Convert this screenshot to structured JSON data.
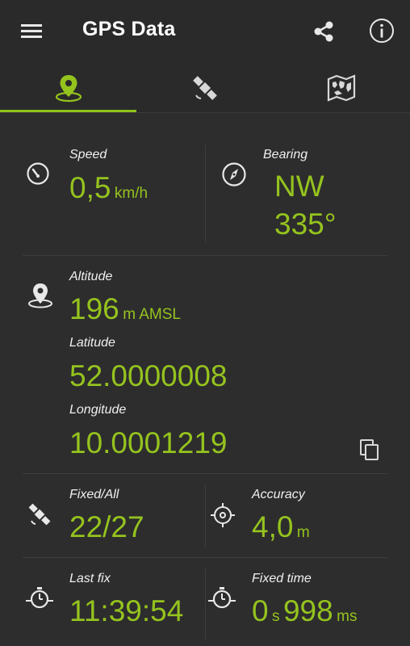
{
  "app": {
    "title": "GPS Data"
  },
  "colors": {
    "accent": "#95c31e",
    "background": "#2d2d2d",
    "appbar": "#2a2a2a"
  },
  "toolbar": {
    "icons": [
      "menu-icon",
      "share-icon",
      "info-icon"
    ]
  },
  "tabs": [
    {
      "icon": "location-pin-icon",
      "selected": true
    },
    {
      "icon": "satellite-icon",
      "selected": false
    },
    {
      "icon": "map-icon",
      "selected": false
    }
  ],
  "speed": {
    "label": "Speed",
    "value": "0,5",
    "unit": "km/h"
  },
  "bearing": {
    "label": "Bearing",
    "direction": "NW",
    "degrees": "335°"
  },
  "altitude": {
    "label": "Altitude",
    "value": "196",
    "unit": "m AMSL"
  },
  "latitude": {
    "label": "Latitude",
    "value": "52.0000008"
  },
  "longitude": {
    "label": "Longitude",
    "value": "10.0001219"
  },
  "satellites": {
    "label": "Fixed/All",
    "value": "22/27"
  },
  "accuracy": {
    "label": "Accuracy",
    "value": "4,0",
    "unit": "m"
  },
  "last_fix": {
    "label": "Last fix",
    "value": "11:39:54"
  },
  "fixed_time": {
    "label": "Fixed time",
    "seconds": "0",
    "seconds_unit": "s",
    "ms": "998",
    "ms_unit": "ms"
  }
}
